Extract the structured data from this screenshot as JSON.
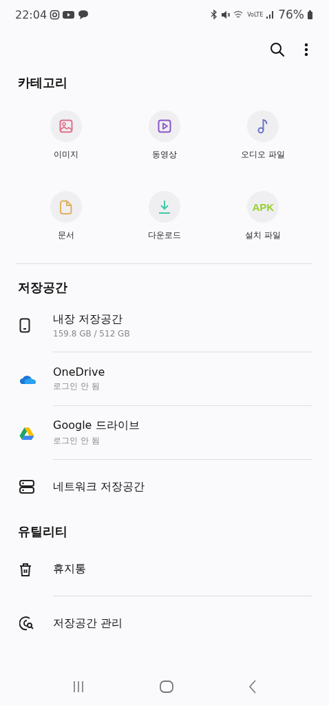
{
  "status_bar": {
    "time": "22:04",
    "network_label": "VoLTE",
    "battery": "76%"
  },
  "categories": {
    "title": "카테고리",
    "items": [
      {
        "kind": "image",
        "label": "이미지",
        "color": "#e0708a"
      },
      {
        "kind": "video",
        "label": "동영상",
        "color": "#8a55c8"
      },
      {
        "kind": "audio",
        "label": "오디오 파일",
        "color": "#6a78c8"
      },
      {
        "kind": "document",
        "label": "문서",
        "color": "#e0b060"
      },
      {
        "kind": "download",
        "label": "다운로드",
        "color": "#40c8a8"
      },
      {
        "kind": "apk",
        "label": "설치 파일",
        "color": "#98d030",
        "badge": "APK"
      }
    ]
  },
  "storage": {
    "title": "저장공간",
    "items": [
      {
        "kind": "phone",
        "label": "내장 저장공간",
        "detail": "159.8 GB / 512 GB"
      },
      {
        "kind": "onedrive",
        "label": "OneDrive",
        "detail": "로그인 안 됨"
      },
      {
        "kind": "gdrive",
        "label": "Google 드라이브",
        "detail": "로그인 안 됨"
      },
      {
        "kind": "network",
        "label": "네트워크 저장공간"
      }
    ]
  },
  "utilities": {
    "title": "유틸리티",
    "items": [
      {
        "kind": "trash",
        "label": "휴지통"
      },
      {
        "kind": "analysis",
        "label": "저장공간 관리"
      }
    ]
  }
}
